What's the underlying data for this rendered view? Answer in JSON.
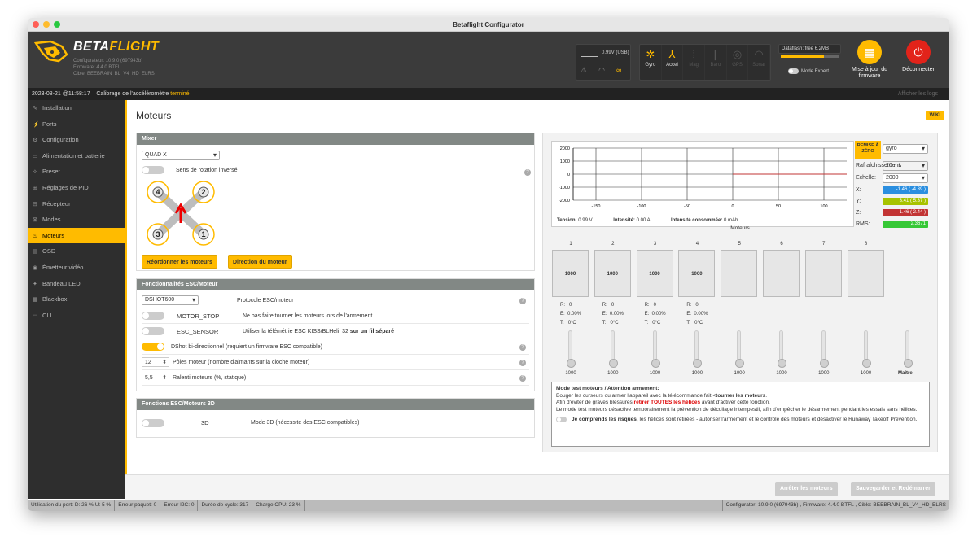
{
  "window": {
    "title": "Betaflight Configurator"
  },
  "header": {
    "logo_prefix": "BETA",
    "logo_suffix": "FLIGHT",
    "configurator": "Configurateur: 10.9.0 (697943b)",
    "firmware": "Firmware: 4.4.0 BTFL",
    "target": "Cible: BEEBRAIN_BL_V4_HD_ELRS",
    "battery_voltage": "0.99V (USB)",
    "sensors": [
      {
        "label": "Gyro",
        "icon": "gyro-icon",
        "glyph": "✲",
        "active": true
      },
      {
        "label": "Accel",
        "icon": "accel-icon",
        "glyph": "⅄",
        "active": true
      },
      {
        "label": "Mag",
        "icon": "mag-icon",
        "glyph": "⦙",
        "active": false
      },
      {
        "label": "Baro",
        "icon": "baro-icon",
        "glyph": "❙",
        "active": false
      },
      {
        "label": "GPS",
        "icon": "gps-icon",
        "glyph": "◎",
        "active": false
      },
      {
        "label": "Sonar",
        "icon": "sonar-icon",
        "glyph": "◠",
        "active": false
      }
    ],
    "dataflash": "Dataflash: free 6.2MB",
    "dataflash_used_fraction": 0.75,
    "expert_mode": "Mode Expert",
    "firmware_update": "Mise à jour du firmware",
    "disconnect": "Déconnecter"
  },
  "log": {
    "timestamp": "2023-08-21 @11:58:17 – Calibrage de l'accéléromètre",
    "status": "terminé",
    "show_logs": "Afficher les logs"
  },
  "sidebar": {
    "items": [
      {
        "label": "Installation",
        "icon": "wrench-icon",
        "glyph": "✎",
        "active": false
      },
      {
        "label": "Ports",
        "icon": "plug-icon",
        "glyph": "⚡",
        "active": false
      },
      {
        "label": "Configuration",
        "icon": "gear-icon",
        "glyph": "⚙",
        "active": false
      },
      {
        "label": "Alimentation et batterie",
        "icon": "battery-icon",
        "glyph": "▭",
        "active": false
      },
      {
        "label": "Preset",
        "icon": "magic-icon",
        "glyph": "✧",
        "active": false
      },
      {
        "label": "Réglages de PID",
        "icon": "pid-icon",
        "glyph": "⊞",
        "active": false
      },
      {
        "label": "Récepteur",
        "icon": "receiver-icon",
        "glyph": "⊟",
        "active": false
      },
      {
        "label": "Modes",
        "icon": "modes-icon",
        "glyph": "⊠",
        "active": false
      },
      {
        "label": "Moteurs",
        "icon": "motor-icon",
        "glyph": "♨",
        "active": true
      },
      {
        "label": "OSD",
        "icon": "osd-icon",
        "glyph": "▤",
        "active": false
      },
      {
        "label": "Émetteur vidéo",
        "icon": "vtx-icon",
        "glyph": "◉",
        "active": false
      },
      {
        "label": "Bandeau LED",
        "icon": "led-icon",
        "glyph": "✦",
        "active": false
      },
      {
        "label": "Blackbox",
        "icon": "blackbox-icon",
        "glyph": "▦",
        "active": false
      },
      {
        "label": "CLI",
        "icon": "cli-icon",
        "glyph": "▭",
        "active": false
      }
    ]
  },
  "page": {
    "title": "Moteurs",
    "wiki": "WIKI"
  },
  "mixer": {
    "header": "Mixer",
    "type": "QUAD X",
    "reverse_label": "Sens de rotation inversé",
    "motor_labels": [
      "4",
      "2",
      "3",
      "1"
    ],
    "reorder_button": "Réordonner les moteurs",
    "direction_button": "Direction du moteur"
  },
  "esc": {
    "header": "Fonctionnalités ESC/Moteur",
    "protocol": "DSHOT600",
    "protocol_label": "Protocole ESC/moteur",
    "motor_stop": "MOTOR_STOP",
    "motor_stop_desc": "Ne pas faire tourner les moteurs lors de l'armement",
    "esc_sensor": "ESC_SENSOR",
    "esc_sensor_desc": "Utiliser la télémétrie ESC KISS/BLHeli_32",
    "esc_sensor_bold": "sur un fil séparé",
    "bidir": "DShot bi-directionnel (requiert un firmware ESC compatible)",
    "poles_value": "12",
    "poles_label": "Pôles moteur (nombre d'aimants sur la cloche moteur)",
    "idle_value": "5,5",
    "idle_label": "Ralenti moteurs (%, statique)"
  },
  "esc3d": {
    "header": "Fonctions ESC/Moteurs 3D",
    "label": "3D",
    "desc": "Mode 3D (nécessite des ESC compatibles)"
  },
  "graph": {
    "y_ticks": [
      "2000",
      "1000",
      "0",
      "-1000",
      "-2000"
    ],
    "x_ticks": [
      "-150",
      "-100",
      "-50",
      "0",
      "50",
      "100"
    ],
    "tension_label": "Tension:",
    "tension": "0.99 V",
    "intensity_label": "Intensité:",
    "intensity": "0.00 A",
    "consumed_label": "Intensité consommée:",
    "consumed": "0 mAh",
    "reset": "REMISE À ZÉRO",
    "source": "gyro",
    "refresh_label": "Rafraîchissement:",
    "refresh": "20 ms",
    "scale_label": "Echelle:",
    "scale": "2000",
    "readings": [
      {
        "label": "X:",
        "value": "-1.46 ( -4.39 )",
        "color": "#2b8fe0"
      },
      {
        "label": "Y:",
        "value": "3.41 ( 5.37 )",
        "color": "#a7c300"
      },
      {
        "label": "Z:",
        "value": "1.46 ( 2.44 )",
        "color": "#c23434"
      },
      {
        "label": "RMS:",
        "value": "2.3671",
        "color": "#36c836"
      }
    ]
  },
  "motors": {
    "title": "Moteurs",
    "columns": [
      {
        "num": "1",
        "val": "1000",
        "r": "0",
        "e": "0.00%",
        "t": "0°C",
        "slider": "1000"
      },
      {
        "num": "2",
        "val": "1000",
        "r": "0",
        "e": "0.00%",
        "t": "0°C",
        "slider": "1000"
      },
      {
        "num": "3",
        "val": "1000",
        "r": "0",
        "e": "0.00%",
        "t": "0°C",
        "slider": "1000"
      },
      {
        "num": "4",
        "val": "1000",
        "r": "0",
        "e": "0.00%",
        "t": "0°C",
        "slider": "1000"
      },
      {
        "num": "5",
        "val": "",
        "slider": "1000"
      },
      {
        "num": "6",
        "val": "",
        "slider": "1000"
      },
      {
        "num": "7",
        "val": "",
        "slider": "1000"
      },
      {
        "num": "8",
        "val": "",
        "slider": "1000"
      }
    ],
    "master_label": "Maître",
    "r_label": "R:",
    "e_label": "E:",
    "t_label": "T:"
  },
  "notice": {
    "title": "Mode test moteurs / Attention armement:",
    "l1a": "Bouger les curseurs ou armer l'appareil avec la télécommande fait <",
    "l1b": "tourner les moteurs",
    "l1c": ".",
    "l2a": "Afin d'éviter de graves blessures ",
    "l2b": "retirer TOUTES les hélices",
    "l2c": " avant d'activer cette fonction.",
    "l3": "Le mode test moteurs désactive temporairement la prévention de décollage intempestif, afin d'empêcher le désarmement pendant les essais sans hélices.",
    "confirm_bold": "Je comprends les risques",
    "confirm_rest": ", les hélices sont retirées - autoriser l'armement et le contrôle des moteurs et désactiver le Runaway Takeoff Prevention."
  },
  "actions": {
    "stop": "Arrêter les moteurs",
    "save": "Sauvegarder et Redémarrer"
  },
  "status": {
    "port": "Utilisation du port: D: 26 % U: 5 %",
    "packet": "Erreur paquet: 0",
    "i2c": "Erreur I2C: 0",
    "cycle": "Durée de cycle: 317",
    "cpu": "Charge CPU: 23 %",
    "version": "Configurator: 10.9.0 (697943b) , Firmware: 4.4.0 BTFL , Cible: BEEBRAIN_BL_V4_HD_ELRS"
  },
  "colors": {
    "accent": "#ffbb00",
    "header_bg": "#3b3b3b",
    "sidebar_bg": "#2e2e2e",
    "disconnect": "#e2231a"
  }
}
